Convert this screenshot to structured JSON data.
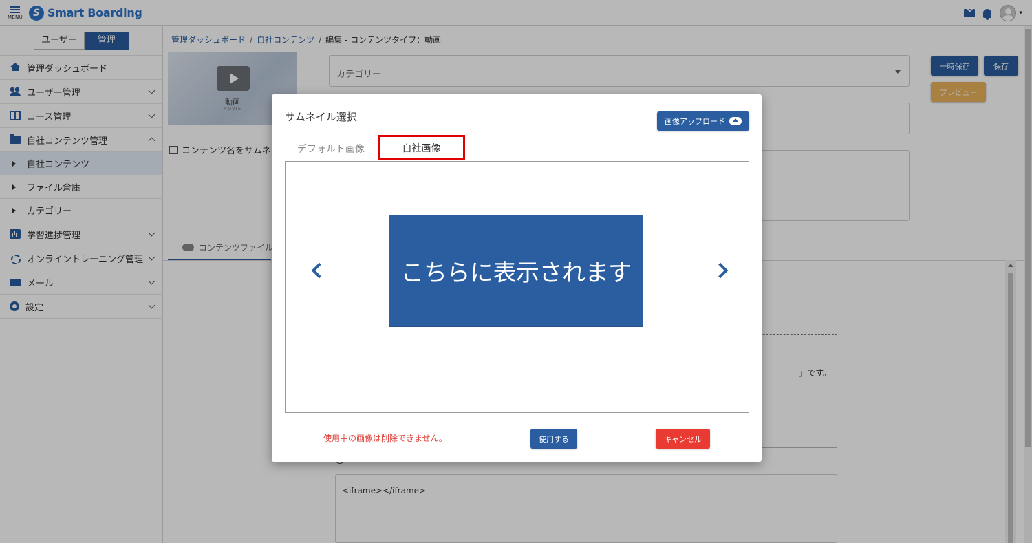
{
  "header": {
    "menu_label": "MENU",
    "logo_mark": "S",
    "logo_text": "Smart Boarding",
    "icons": [
      "mail-icon",
      "bell-icon",
      "avatar"
    ]
  },
  "sidebar": {
    "role_user": "ユーザー",
    "role_admin": "管理",
    "items": [
      {
        "label": "管理ダッシュボード",
        "icon": "home-icon"
      },
      {
        "label": "ユーザー管理",
        "icon": "users-icon"
      },
      {
        "label": "コース管理",
        "icon": "book-icon"
      },
      {
        "label": "自社コンテンツ管理",
        "icon": "folder-icon"
      },
      {
        "label": "学習進捗管理",
        "icon": "chart-icon"
      },
      {
        "label": "オンライントレーニング管理",
        "icon": "online-icon"
      },
      {
        "label": "メール",
        "icon": "mail-icon"
      },
      {
        "label": "設定",
        "icon": "gear-icon"
      }
    ],
    "subitems": [
      "自社コンテンツ",
      "ファイル倉庫",
      "カテゴリー"
    ]
  },
  "main": {
    "breadcrumb": [
      "管理ダッシュボード",
      "自社コンテンツ",
      "編集 - コンテンツタイプ：動画"
    ],
    "thumb_label": "動画",
    "thumb_sub": "MOVIE",
    "thumb_checkbox": "コンテンツ名をサムネイ",
    "category_placeholder": "カテゴリー",
    "btn_temp_save": "一時保存",
    "btn_save": "保存",
    "btn_preview": "プレビュー",
    "tab_content_file": "コンテンツファイル",
    "dashed_text": "」です。",
    "iframe_value": "<iframe></iframe>"
  },
  "modal": {
    "title": "サムネイル選択",
    "upload_label": "画像アップロード",
    "tab_default": "デフォルト画像",
    "tab_own": "自社画像",
    "slide_text": "こちらに表示されます",
    "warning": "使用中の画像は削除できません。",
    "use_label": "使用する",
    "cancel_label": "キャンセル"
  },
  "colors": {
    "primary": "#2a5ea0",
    "accent_red": "#ea3b32",
    "highlight_border": "#e00000",
    "preview_orange": "#e8b25c"
  }
}
